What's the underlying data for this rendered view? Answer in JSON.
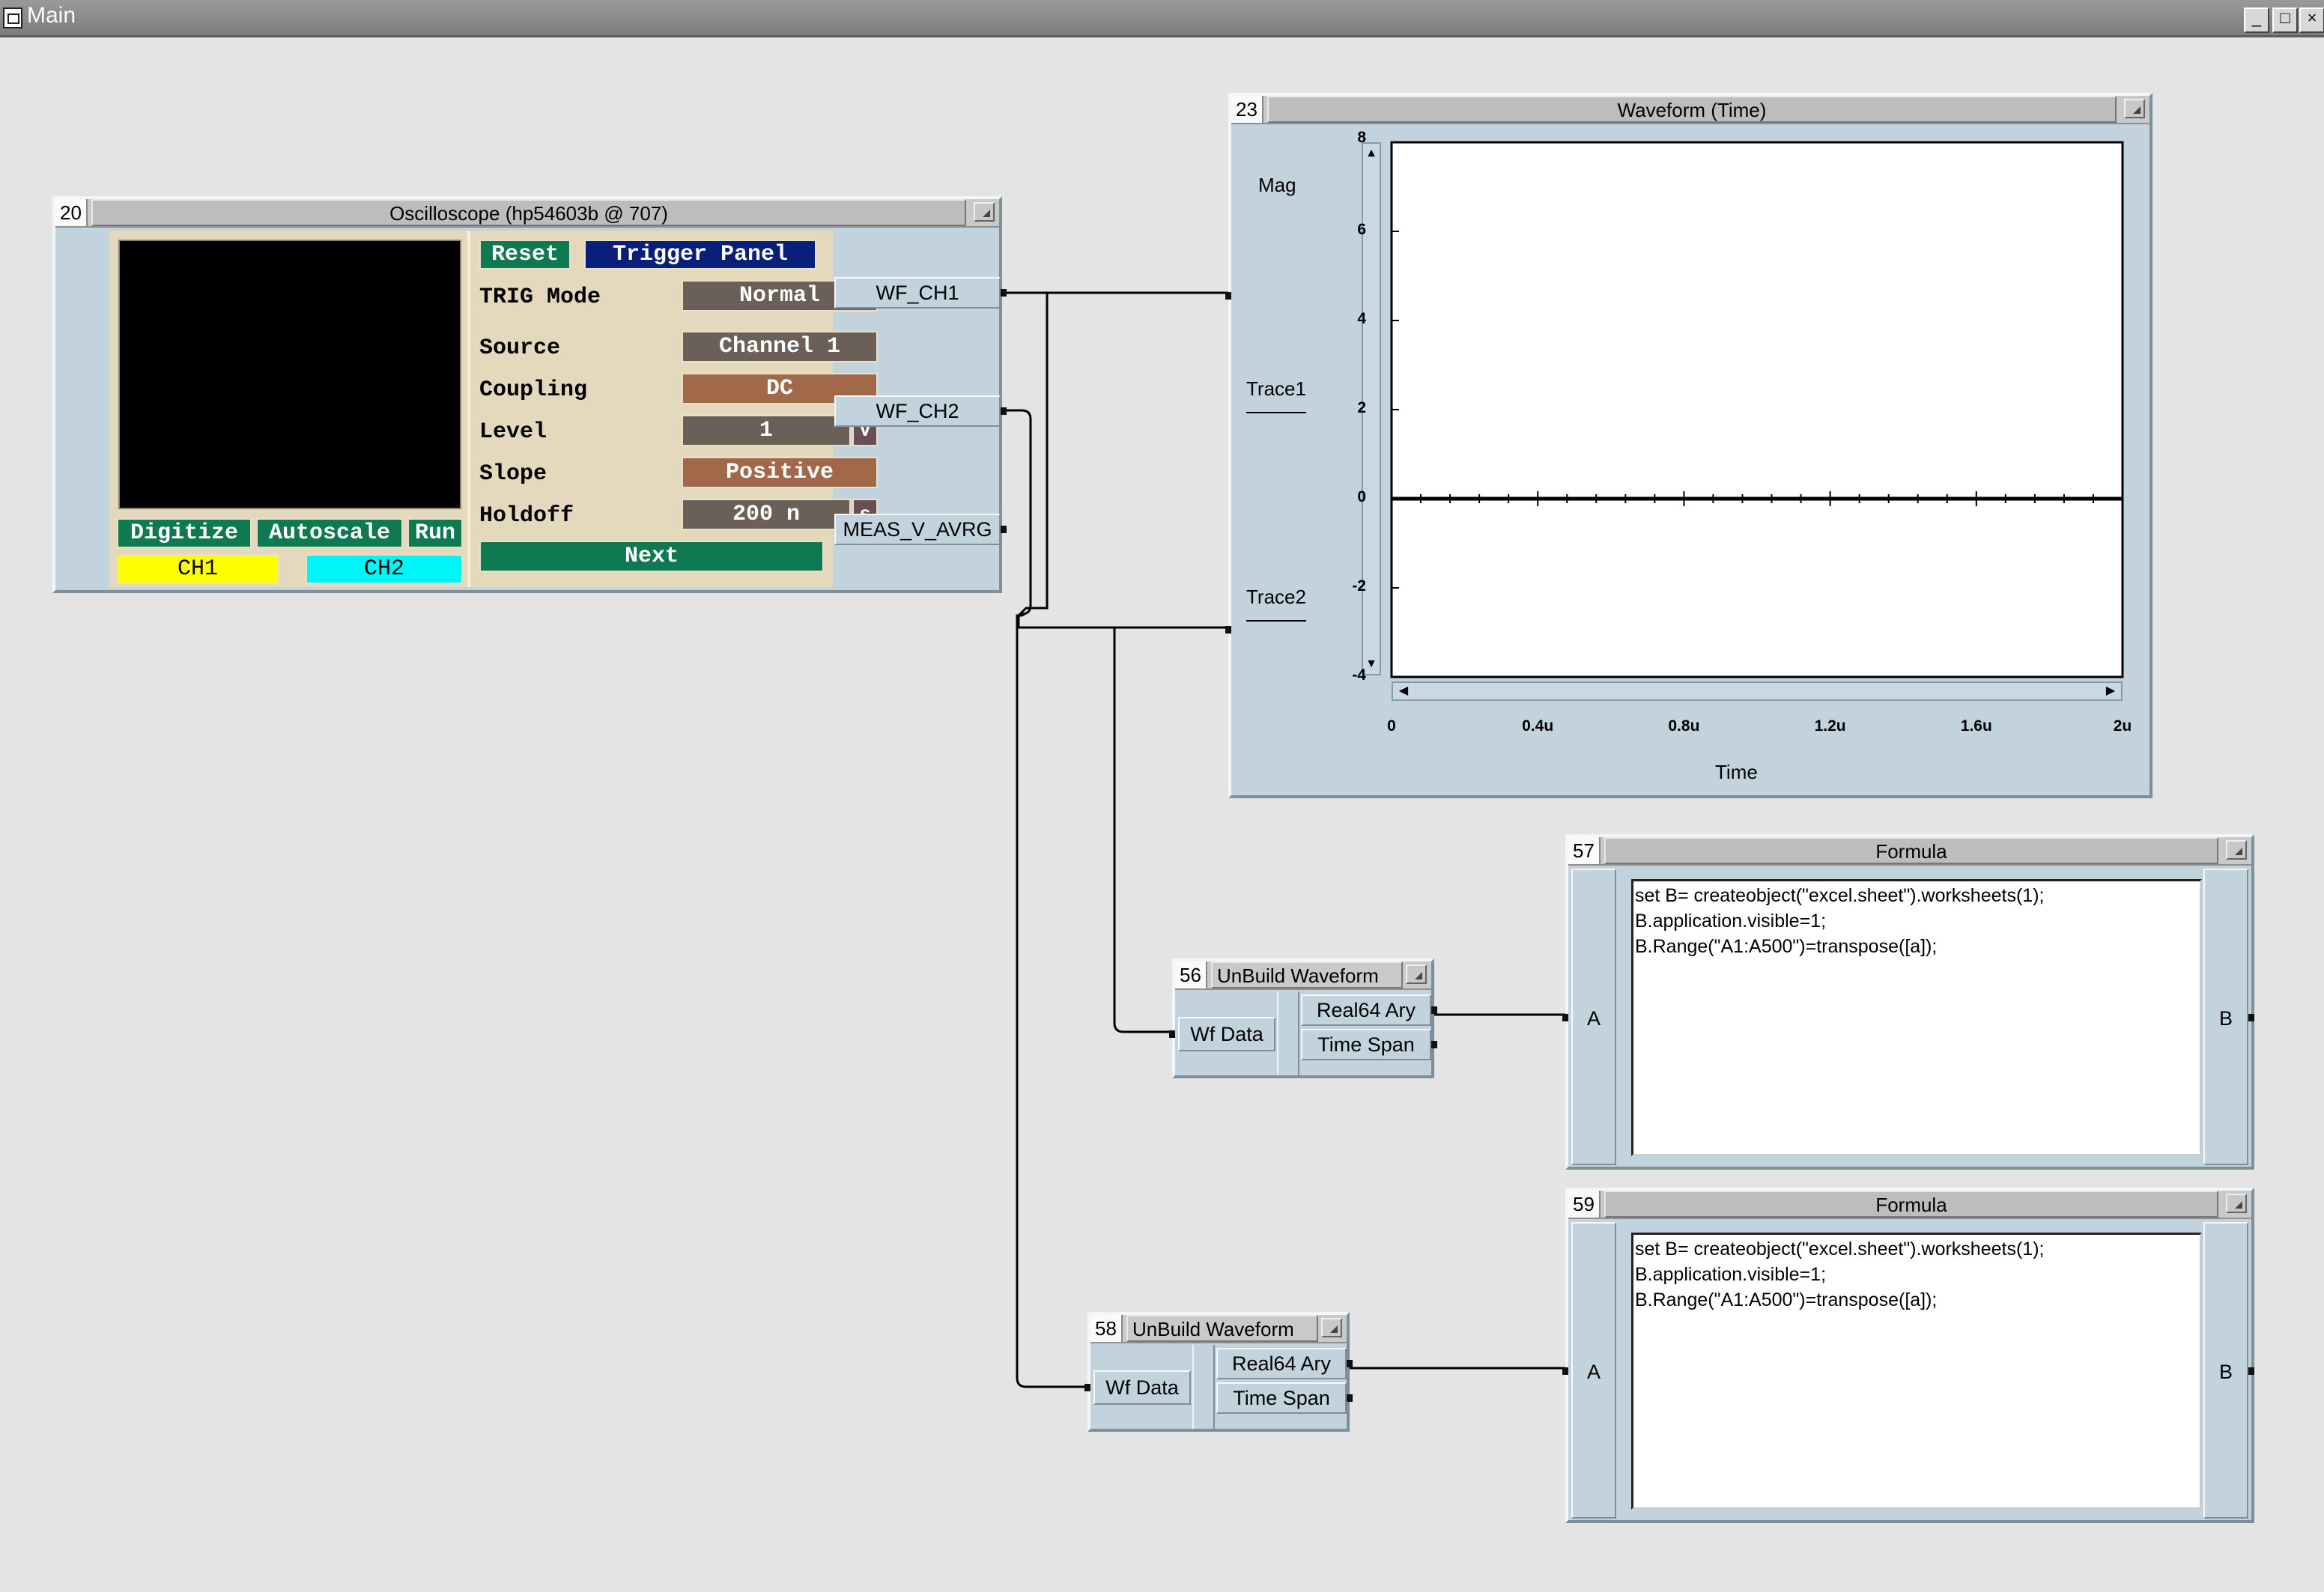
{
  "window": {
    "title": "Main",
    "buttons": [
      "minimize",
      "maximize",
      "close"
    ]
  },
  "oscilloscope": {
    "number": "20",
    "title": "Oscilloscope (hp54603b @ 707)",
    "buttons": {
      "reset": "Reset",
      "trigger_panel": "Trigger Panel",
      "digitize": "Digitize",
      "autoscale": "Autoscale",
      "run": "Run",
      "next": "Next"
    },
    "channels": {
      "ch1": "CH1",
      "ch2": "CH2"
    },
    "settings": {
      "trig_mode": {
        "label": "TRIG Mode",
        "value": "Normal"
      },
      "source": {
        "label": "Source",
        "value": "Channel 1"
      },
      "coupling": {
        "label": "Coupling",
        "value": "DC"
      },
      "level": {
        "label": "Level",
        "value": "1",
        "unit": "V"
      },
      "slope": {
        "label": "Slope",
        "value": "Positive"
      },
      "holdoff": {
        "label": "Holdoff",
        "value": "200 n",
        "unit": "s"
      }
    },
    "outputs": [
      "WF_CH1",
      "WF_CH2",
      "MEAS_V_AVRG"
    ]
  },
  "waveform": {
    "number": "23",
    "title": "Waveform (Time)",
    "y_label": "Mag",
    "x_label": "Time",
    "inputs": [
      "Trace1",
      "Trace2"
    ]
  },
  "chart_data": {
    "type": "line",
    "title": "Waveform (Time)",
    "xlabel": "Time",
    "ylabel": "Mag",
    "xlim": [
      0,
      2
    ],
    "ylim": [
      -4,
      8
    ],
    "x_ticks": [
      "0",
      "0.4u",
      "0.8u",
      "1.2u",
      "1.6u",
      "2u"
    ],
    "y_ticks": [
      "8",
      "6",
      "4",
      "2",
      "0",
      "-2",
      "-4"
    ],
    "series": [
      {
        "name": "Trace1",
        "x": [
          0,
          2
        ],
        "y": [
          0,
          0
        ]
      },
      {
        "name": "Trace2",
        "x": [
          0,
          2
        ],
        "y": [
          0,
          0
        ]
      }
    ],
    "grid": false
  },
  "unbuild1": {
    "number": "56",
    "title": "UnBuild Waveform",
    "input": "Wf Data",
    "outputs": [
      "Real64 Ary",
      "Time Span"
    ]
  },
  "unbuild2": {
    "number": "58",
    "title": "UnBuild Waveform",
    "input": "Wf Data",
    "outputs": [
      "Real64 Ary",
      "Time Span"
    ]
  },
  "formula1": {
    "number": "57",
    "title": "Formula",
    "input": "A",
    "output": "B",
    "code": "set B= createobject(\"excel.sheet\").worksheets(1);\nB.application.visible=1;\nB.Range(\"A1:A500\")=transpose([a]);"
  },
  "formula2": {
    "number": "59",
    "title": "Formula",
    "input": "A",
    "output": "B",
    "code": "set B= createobject(\"excel.sheet\").worksheets(1);\nB.application.visible=1;\nB.Range(\"A1:A500\")=transpose([a]);"
  },
  "colors": {
    "workspace": "#e4e4e4",
    "object_body": "#c3d3dd",
    "scope_panel": "#e4d9bd",
    "button_green": "#0f7a52",
    "button_navy": "#0a1f7a",
    "field_gray": "#6a6057",
    "field_brown": "#a2684a",
    "ch1": "#ffff00",
    "ch2": "#00f6f6"
  }
}
